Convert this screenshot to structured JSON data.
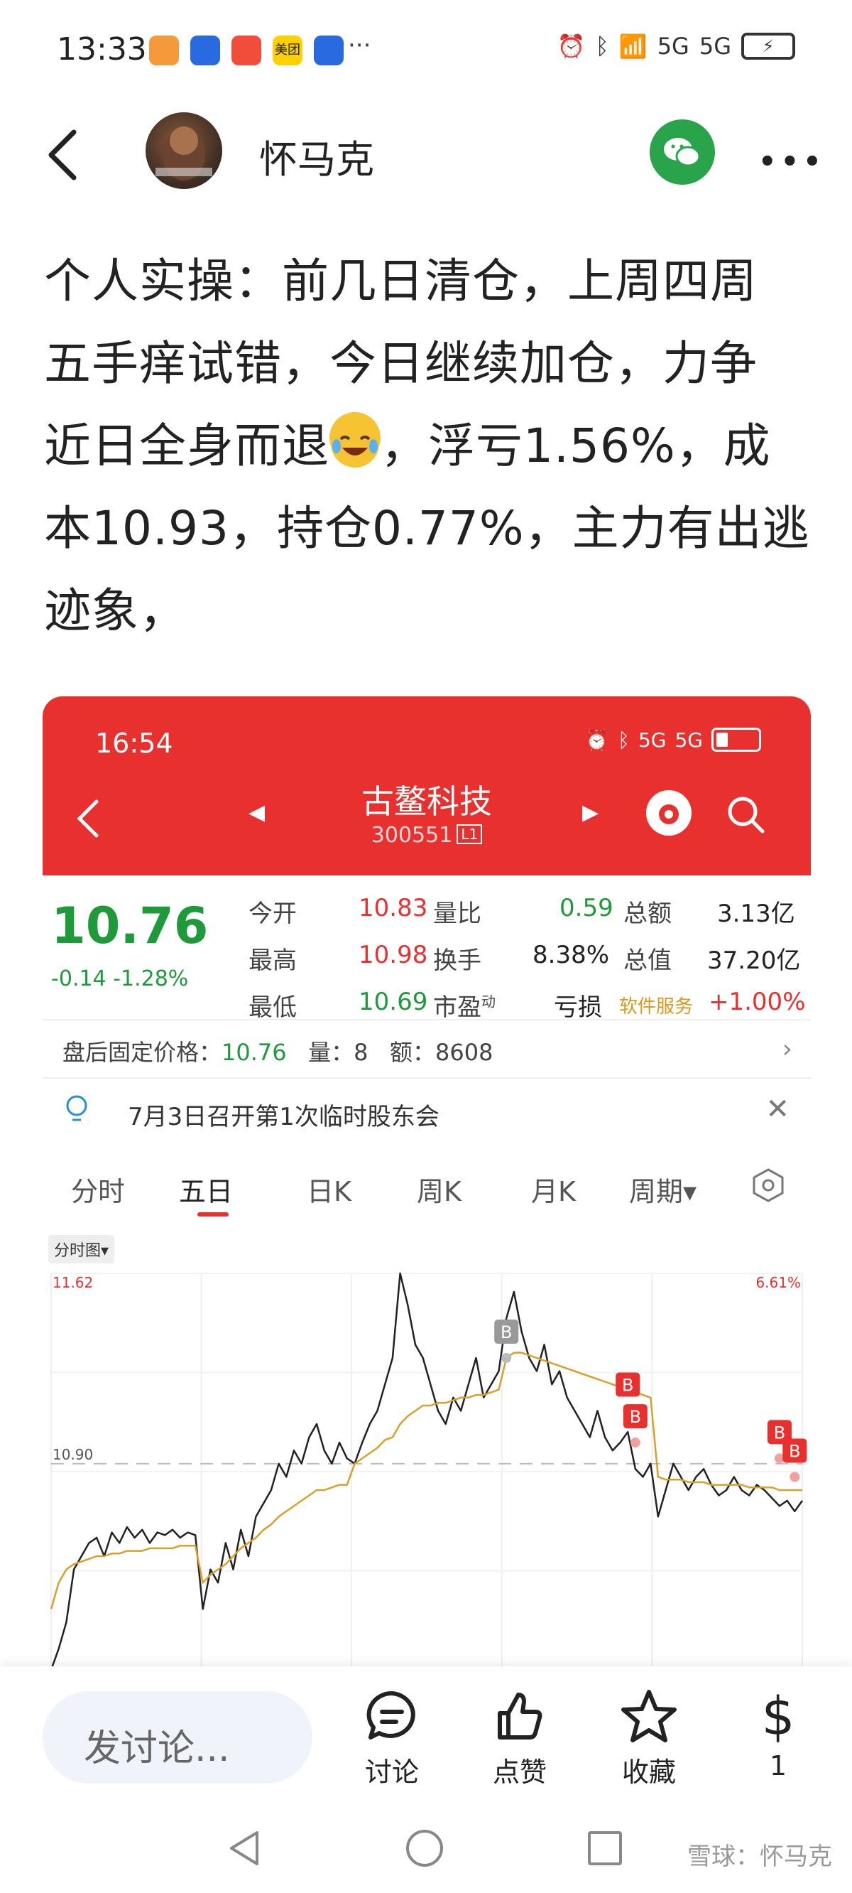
{
  "status_bar": {
    "time": "13:33",
    "app_icons": [
      {
        "name": "shield-app-icon",
        "color": "#f59a3a"
      },
      {
        "name": "map-app-icon",
        "color": "#2a6ae0"
      },
      {
        "name": "grid-app-icon",
        "color": "#f24c3a"
      },
      {
        "name": "meituan-app-icon",
        "color": "#ffd000",
        "label": "美团"
      },
      {
        "name": "map2-app-icon",
        "color": "#2a6ae0"
      }
    ],
    "more": "···",
    "signal_1": "5G",
    "signal_2": "5G"
  },
  "header": {
    "author": "怀马克"
  },
  "post": {
    "lines": [
      "个人实操：前几日清仓，上周四周",
      "五手痒试错，今日继续加仓，力争",
      "近日全身而退",
      "，浮亏1.56%，成",
      "本10.93，持仓0.77%，主力有出逃",
      "迹象，"
    ]
  },
  "embed": {
    "time": "16:54",
    "signal_1": "5G",
    "signal_2": "5G",
    "stock_name": "古鳌科技",
    "stock_code": "300551",
    "level": "L1",
    "price": "10.76",
    "change": "-0.14",
    "change_pct": "-1.28%",
    "quote": {
      "open_label": "今开",
      "open": "10.83",
      "vol_ratio_label": "量比",
      "vol_ratio": "0.59",
      "amount_label": "总额",
      "amount": "3.13亿",
      "high_label": "最高",
      "high": "10.98",
      "turnover_label": "换手",
      "turnover": "8.38%",
      "mktcap_label": "总值",
      "mktcap": "37.20亿",
      "low_label": "最低",
      "low": "10.69",
      "pe_label": "市盈",
      "pe_sup": "动",
      "pe_value": "亏损",
      "software_label": "软件服务",
      "sector_change": "+1.00%"
    },
    "after_hours": {
      "label": "盘后固定价格：",
      "price": "10.76",
      "vol_label": "量：",
      "vol": "8",
      "amt_label": "额：",
      "amt": "8608"
    },
    "notice": "7月3日召开第1次临时股东会",
    "tabs": [
      "分时",
      "五日",
      "日K",
      "周K",
      "月K",
      "周期▾"
    ],
    "active_tab": 1,
    "chart_type_label": "分时图▾",
    "colors": {
      "red": "#e8302e",
      "green": "#1f9a3a",
      "avg_line": "#d8a02a"
    }
  },
  "chart_data": {
    "type": "line",
    "title": "",
    "xlabel": "",
    "ylabel": "",
    "y_left_top": "11.62",
    "y_left_mid": "10.90",
    "y_right_top": "6.61%",
    "ylim": [
      10.12,
      11.62
    ],
    "reference": 10.9,
    "days": 5,
    "series": [
      {
        "values": [
          10.12,
          10.2,
          10.3,
          10.5,
          10.55,
          10.6,
          10.62,
          10.55,
          10.64,
          10.6,
          10.66,
          10.62,
          10.65,
          10.6,
          10.64,
          10.63,
          10.65,
          10.62,
          10.64,
          10.63,
          10.35,
          10.5,
          10.45,
          10.6,
          10.5,
          10.65,
          10.55,
          10.7,
          10.75,
          10.8,
          10.9,
          10.85,
          10.95,
          10.9,
          11.0,
          11.05,
          10.95,
          10.9,
          10.98,
          10.92,
          10.9,
          10.98,
          11.05,
          11.1,
          11.2,
          11.3,
          11.62,
          11.5,
          11.35,
          11.3,
          11.2,
          11.1,
          11.05,
          11.15,
          11.1,
          11.2,
          11.3,
          11.15,
          11.2,
          11.25,
          11.45,
          11.55,
          11.4,
          11.3,
          11.25,
          11.35,
          11.2,
          11.25,
          11.15,
          11.1,
          11.05,
          11.0,
          11.1,
          11.0,
          10.95,
          10.98,
          11.02,
          10.88,
          10.85,
          10.9,
          10.7,
          10.8,
          10.9,
          10.85,
          10.8,
          10.85,
          10.88,
          10.82,
          10.78,
          10.8,
          10.85,
          10.8,
          10.78,
          10.82,
          10.8,
          10.77,
          10.74,
          10.76,
          10.72,
          10.76
        ]
      },
      {
        "values": [
          10.35,
          10.45,
          10.5,
          10.52,
          10.53,
          10.54,
          10.55,
          10.55,
          10.56,
          10.56,
          10.57,
          10.57,
          10.57,
          10.58,
          10.58,
          10.58,
          10.58,
          10.59,
          10.59,
          10.59,
          10.45,
          10.48,
          10.5,
          10.52,
          10.55,
          10.58,
          10.6,
          10.62,
          10.65,
          10.67,
          10.7,
          10.72,
          10.74,
          10.76,
          10.78,
          10.8,
          10.8,
          10.81,
          10.82,
          10.82,
          10.9,
          10.92,
          10.94,
          10.96,
          10.99,
          11.0,
          11.05,
          11.08,
          11.1,
          11.12,
          11.12,
          11.13,
          11.13,
          11.14,
          11.15,
          11.15,
          11.16,
          11.16,
          11.17,
          11.18,
          11.3,
          11.32,
          11.32,
          11.31,
          11.3,
          11.29,
          11.28,
          11.27,
          11.26,
          11.25,
          11.24,
          11.23,
          11.22,
          11.21,
          11.2,
          11.19,
          11.18,
          11.17,
          11.16,
          11.15,
          10.85,
          10.84,
          10.84,
          10.84,
          10.83,
          10.83,
          10.83,
          10.82,
          10.82,
          10.82,
          10.82,
          10.82,
          10.81,
          10.81,
          10.81,
          10.81,
          10.8,
          10.8,
          10.8,
          10.8
        ]
      }
    ],
    "markers": [
      {
        "label": "B",
        "index": 60,
        "price": 11.3,
        "color": "#999999"
      },
      {
        "label": "B",
        "index": 76,
        "price": 11.1,
        "color": "#e8302e"
      },
      {
        "label": "B",
        "index": 77,
        "price": 10.98,
        "color": "#e8302e"
      },
      {
        "label": "B",
        "index": 96,
        "price": 10.92,
        "color": "#e8302e"
      },
      {
        "label": "B",
        "index": 98,
        "price": 10.85,
        "color": "#e8302e"
      }
    ]
  },
  "actions": {
    "comment_placeholder": "发讨论...",
    "discuss": "讨论",
    "like": "点赞",
    "collect": "收藏",
    "reward_count": "1"
  },
  "watermark": "雪球：怀马克"
}
